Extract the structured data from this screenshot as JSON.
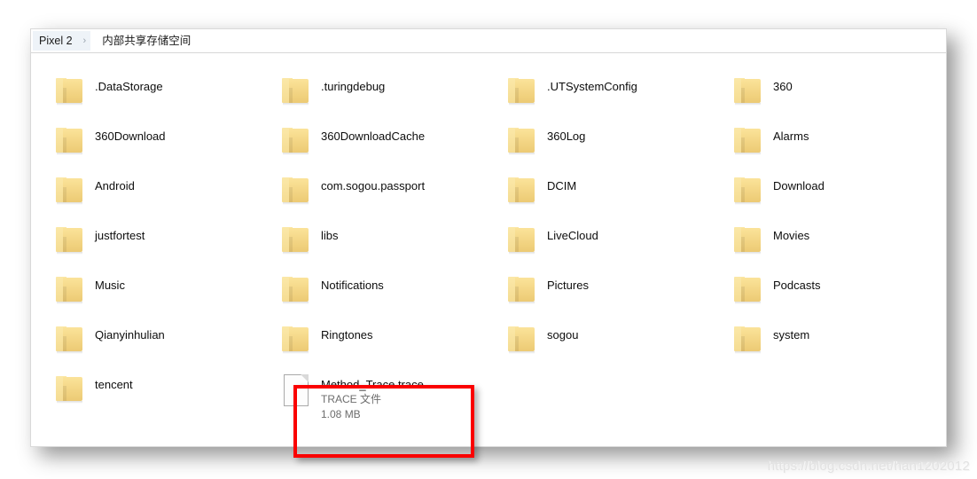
{
  "window": {
    "breadcrumb": {
      "root": "Pixel 2",
      "separator": "›",
      "current": "内部共享存储空间"
    }
  },
  "items": [
    {
      "name": ".DataStorage",
      "type": "folder",
      "col": 0,
      "row": 0
    },
    {
      "name": ".turingdebug",
      "type": "folder",
      "col": 1,
      "row": 0
    },
    {
      "name": ".UTSystemConfig",
      "type": "folder",
      "col": 2,
      "row": 0
    },
    {
      "name": "360",
      "type": "folder",
      "col": 3,
      "row": 0
    },
    {
      "name": "360Download",
      "type": "folder",
      "col": 0,
      "row": 1
    },
    {
      "name": "360DownloadCache",
      "type": "folder",
      "col": 1,
      "row": 1
    },
    {
      "name": "360Log",
      "type": "folder",
      "col": 2,
      "row": 1
    },
    {
      "name": "Alarms",
      "type": "folder",
      "col": 3,
      "row": 1
    },
    {
      "name": "Android",
      "type": "folder",
      "col": 0,
      "row": 2
    },
    {
      "name": "com.sogou.passport",
      "type": "folder",
      "col": 1,
      "row": 2
    },
    {
      "name": "DCIM",
      "type": "folder",
      "col": 2,
      "row": 2
    },
    {
      "name": "Download",
      "type": "folder",
      "col": 3,
      "row": 2
    },
    {
      "name": "justfortest",
      "type": "folder",
      "col": 0,
      "row": 3
    },
    {
      "name": "libs",
      "type": "folder",
      "col": 1,
      "row": 3
    },
    {
      "name": "LiveCloud",
      "type": "folder",
      "col": 2,
      "row": 3
    },
    {
      "name": "Movies",
      "type": "folder",
      "col": 3,
      "row": 3
    },
    {
      "name": "Music",
      "type": "folder",
      "col": 0,
      "row": 4
    },
    {
      "name": "Notifications",
      "type": "folder",
      "col": 1,
      "row": 4
    },
    {
      "name": "Pictures",
      "type": "folder",
      "col": 2,
      "row": 4
    },
    {
      "name": "Podcasts",
      "type": "folder",
      "col": 3,
      "row": 4
    },
    {
      "name": "Qianyinhulian",
      "type": "folder",
      "col": 0,
      "row": 5
    },
    {
      "name": "Ringtones",
      "type": "folder",
      "col": 1,
      "row": 5
    },
    {
      "name": "sogou",
      "type": "folder",
      "col": 2,
      "row": 5
    },
    {
      "name": "system",
      "type": "folder",
      "col": 3,
      "row": 5
    },
    {
      "name": "tencent",
      "type": "folder",
      "col": 0,
      "row": 6
    },
    {
      "name": "Method_Trace.trace",
      "type": "file",
      "filetype": "TRACE 文件",
      "size": "1.08 MB",
      "col": 1,
      "row": 6,
      "highlighted": true
    }
  ],
  "annotation": {
    "color": "#fa0000",
    "target": "Method_Trace.trace"
  },
  "watermark": {
    "text": "https://blog.csdn.net/han1202012"
  }
}
